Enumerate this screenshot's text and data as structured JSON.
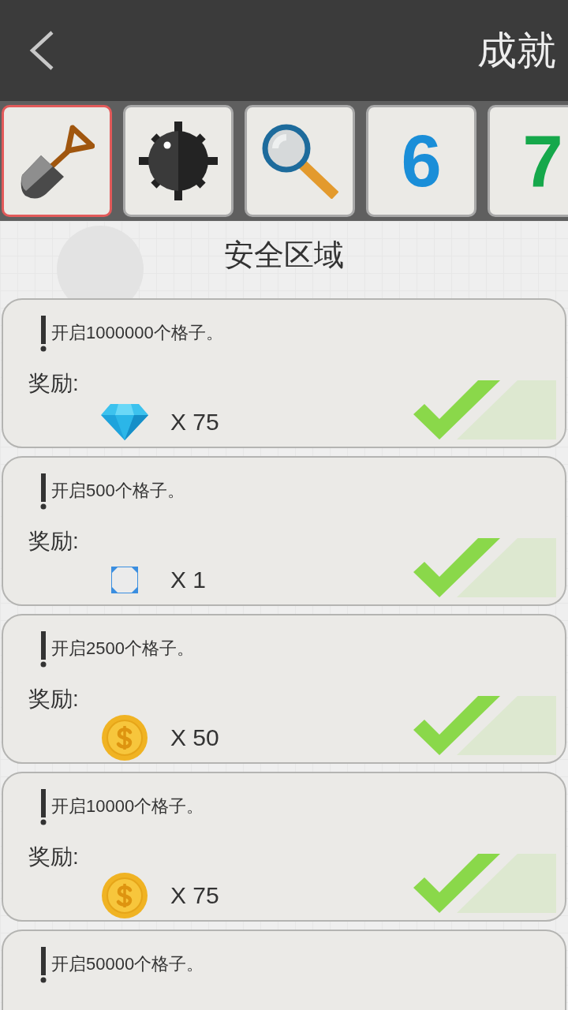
{
  "header": {
    "title": "成就"
  },
  "tabs": [
    {
      "kind": "shovel",
      "selected": true
    },
    {
      "kind": "mine",
      "selected": false
    },
    {
      "kind": "magnifier",
      "selected": false
    },
    {
      "kind": "digit",
      "label": "6",
      "color": "#1a8ed8",
      "selected": false
    },
    {
      "kind": "digit",
      "label": "7",
      "color": "#16a84b",
      "selected": false
    }
  ],
  "section_title": "安全区域",
  "achievements": [
    {
      "task": "开启1000000个格子。",
      "reward_label": "奖励:",
      "reward": {
        "kind": "diamond",
        "count": "X 75"
      },
      "completed": true
    },
    {
      "task": "开启500个格子。",
      "reward_label": "奖励:",
      "reward": {
        "kind": "tile",
        "count": "X 1"
      },
      "completed": true
    },
    {
      "task": "开启2500个格子。",
      "reward_label": "奖励:",
      "reward": {
        "kind": "coin",
        "count": "X 50"
      },
      "completed": true
    },
    {
      "task": "开启10000个格子。",
      "reward_label": "奖励:",
      "reward": {
        "kind": "coin",
        "count": "X 75"
      },
      "completed": true
    },
    {
      "task": "开启50000个格子。"
    }
  ]
}
